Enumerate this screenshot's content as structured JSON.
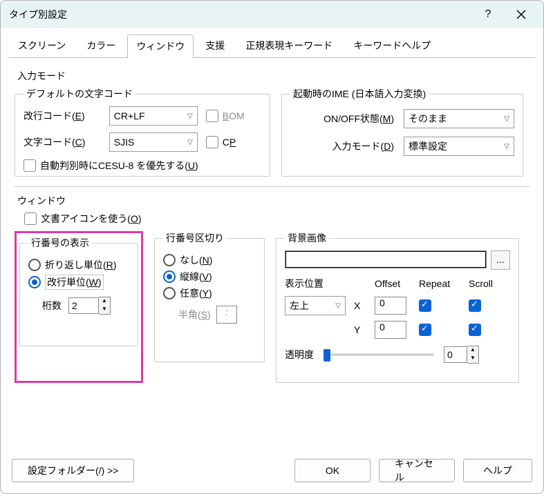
{
  "title": "タイプ別設定",
  "tabs": [
    "スクリーン",
    "カラー",
    "ウィンドウ",
    "支援",
    "正規表現キーワード",
    "キーワードヘルプ"
  ],
  "active_tab": 2,
  "input_mode_label": "入力モード",
  "default_charset": {
    "legend": "デフォルトの文字コード",
    "newline_label": "改行コード(E)",
    "newline_value": "CR+LF",
    "bom_label": "BOM",
    "charset_label": "文字コード(C)",
    "charset_value": "SJIS",
    "cp_label": "CP",
    "cesu_label": "自動判別時にCESU-8 を優先する(U)"
  },
  "startup_ime": {
    "legend": "起動時のIME (日本語入力変換)",
    "onoff_label": "ON/OFF状態(M)",
    "onoff_value": "そのまま",
    "mode_label": "入力モード(D)",
    "mode_value": "標準設定"
  },
  "window_label": "ウィンドウ",
  "doc_icon_label": "文書アイコンを使う(O)",
  "line_num": {
    "legend": "行番号の表示",
    "wrap_label": "折り返し単位(R)",
    "newline_unit_label": "改行単位(W)",
    "digits_label": "桁数",
    "digits_value": "2"
  },
  "line_sep": {
    "legend": "行番号区切り",
    "none_label": "なし(N)",
    "vline_label": "縦線(V)",
    "any_label": "任意(Y)",
    "half_label": "半角(S)",
    "half_value": ":"
  },
  "bg": {
    "legend": "背景画像",
    "pos_label": "表示位置",
    "pos_value": "左上",
    "offset": "Offset",
    "repeat": "Repeat",
    "scroll": "Scroll",
    "x": "X",
    "y": "Y",
    "xval": "0",
    "yval": "0",
    "trans_label": "透明度",
    "trans_value": "0"
  },
  "footer": {
    "settings_folder": "設定フォルダー(/) >>",
    "ok": "OK",
    "cancel": "キャンセル",
    "help": "ヘルプ"
  }
}
